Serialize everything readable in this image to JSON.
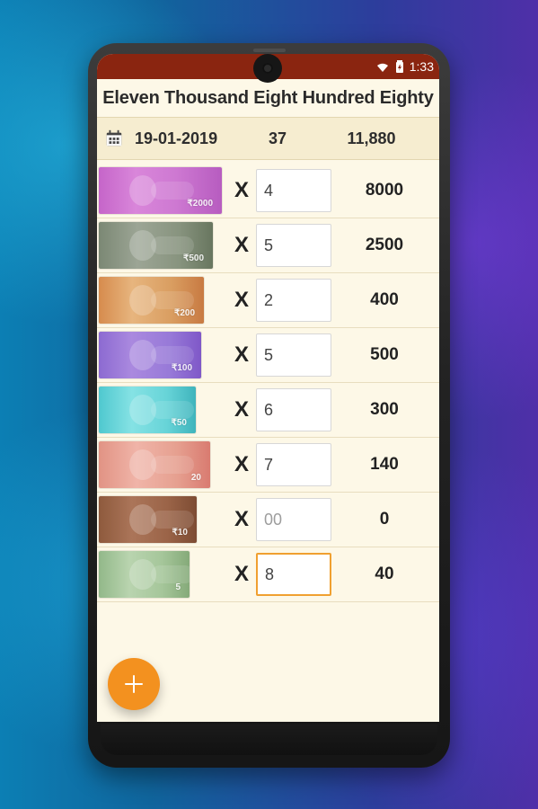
{
  "status_bar": {
    "time": "1:33",
    "icons": {
      "wifi": "wifi-icon",
      "battery": "battery-icon"
    }
  },
  "app": {
    "title": "Eleven Thousand Eight Hundred Eighty"
  },
  "summary": {
    "icon": "calendar-icon",
    "date": "19-01-2019",
    "count": "37",
    "total": "11,880"
  },
  "rows": [
    {
      "multiplier": "X",
      "count_value": "4",
      "count_placeholder": "",
      "row_total": "8000",
      "note_label": "₹2000"
    },
    {
      "multiplier": "X",
      "count_value": "5",
      "count_placeholder": "",
      "row_total": "2500",
      "note_label": "₹500"
    },
    {
      "multiplier": "X",
      "count_value": "2",
      "count_placeholder": "",
      "row_total": "400",
      "note_label": "₹200"
    },
    {
      "multiplier": "X",
      "count_value": "5",
      "count_placeholder": "",
      "row_total": "500",
      "note_label": "₹100"
    },
    {
      "multiplier": "X",
      "count_value": "6",
      "count_placeholder": "",
      "row_total": "300",
      "note_label": "₹50"
    },
    {
      "multiplier": "X",
      "count_value": "7",
      "count_placeholder": "",
      "row_total": "140",
      "note_label": "20"
    },
    {
      "multiplier": "X",
      "count_value": "",
      "count_placeholder": "00",
      "row_total": "0",
      "note_label": "₹10"
    },
    {
      "multiplier": "X",
      "count_value": "8",
      "count_placeholder": "",
      "row_total": "40",
      "note_label": "5"
    }
  ],
  "fab": {
    "icon": "plus-icon"
  },
  "colors": {
    "accent": "#8a2510",
    "screen_bg": "#fdf8e7",
    "fab": "#f3911f",
    "focus_border": "#f0a030"
  }
}
